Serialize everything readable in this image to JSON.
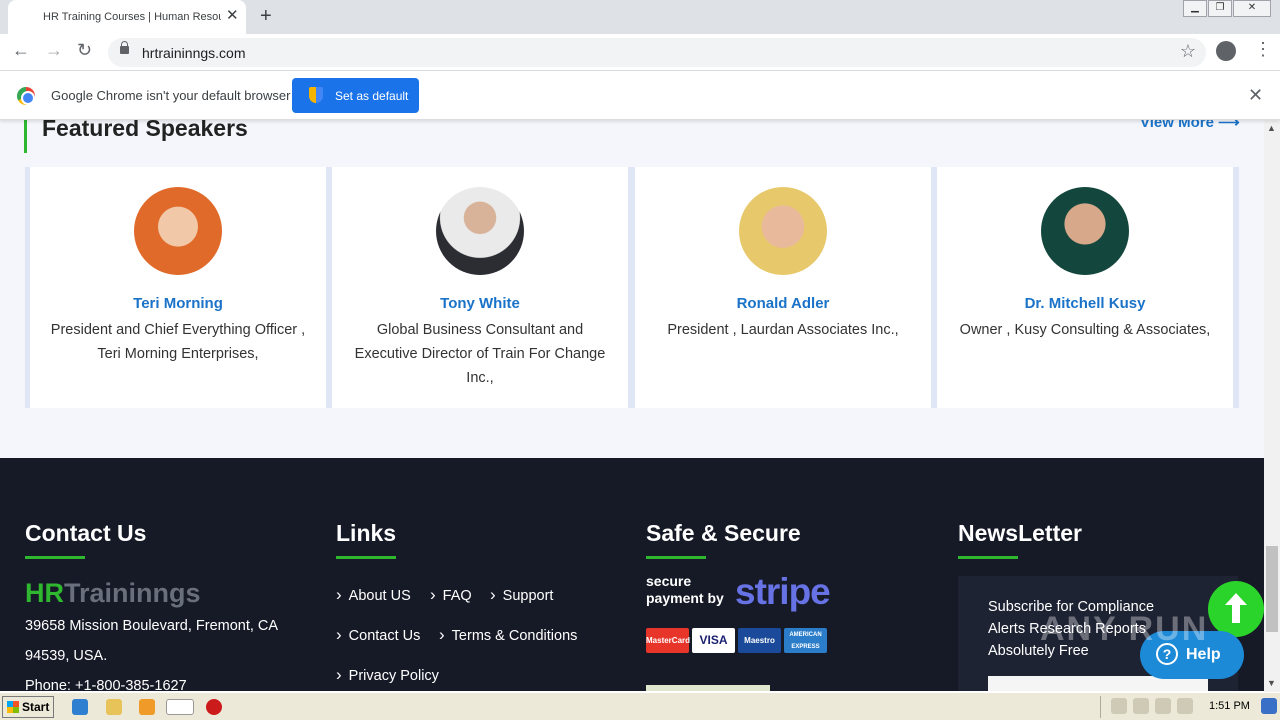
{
  "browser": {
    "tab_title": "HR Training Courses | Human Resources",
    "url": "hrtraininngs.com",
    "infobar_text": "Google Chrome isn't your default browser",
    "infobar_button": "Set as default"
  },
  "page": {
    "section_title": "Featured Speakers",
    "view_more": "View More ⟶",
    "speakers": [
      {
        "name": "Teri Morning",
        "role": "President and Chief Everything Officer , Teri Morning Enterprises,"
      },
      {
        "name": "Tony White",
        "role": "Global Business Consultant and Executive Director of Train For Change Inc.,"
      },
      {
        "name": "Ronald Adler",
        "role": "President , Laurdan Associates Inc.,"
      },
      {
        "name": "Dr. Mitchell Kusy",
        "role": "Owner , Kusy Consulting & Associates,"
      }
    ]
  },
  "footer": {
    "contact_title": "Contact Us",
    "logo_hr": "HR",
    "logo_trainings": "Traininngs",
    "address_line1": "39658 Mission Boulevard, Fremont, CA",
    "address_line2": "94539, USA.",
    "phone": "Phone: +1-800-385-1627",
    "links_title": "Links",
    "links": [
      "About US",
      "FAQ",
      "Support",
      "Contact Us",
      "Terms & Conditions",
      "Privacy Policy"
    ],
    "secure_title": "Safe & Secure",
    "secure_small": "secure",
    "secure_small2": "payment by",
    "secure_brand": "stripe",
    "cards": [
      "MasterCard",
      "VISA",
      "Maestro",
      "AMERICAN EXPRESS"
    ],
    "news_title": "NewsLetter",
    "news_text": "Subscribe for Compliance Alerts Research Reports Absolutely Free"
  },
  "widgets": {
    "help_label": "Help",
    "help_q": "?",
    "watermark": "ANY RUN"
  },
  "taskbar": {
    "start_label": "Start",
    "clock": "1:51 PM"
  }
}
